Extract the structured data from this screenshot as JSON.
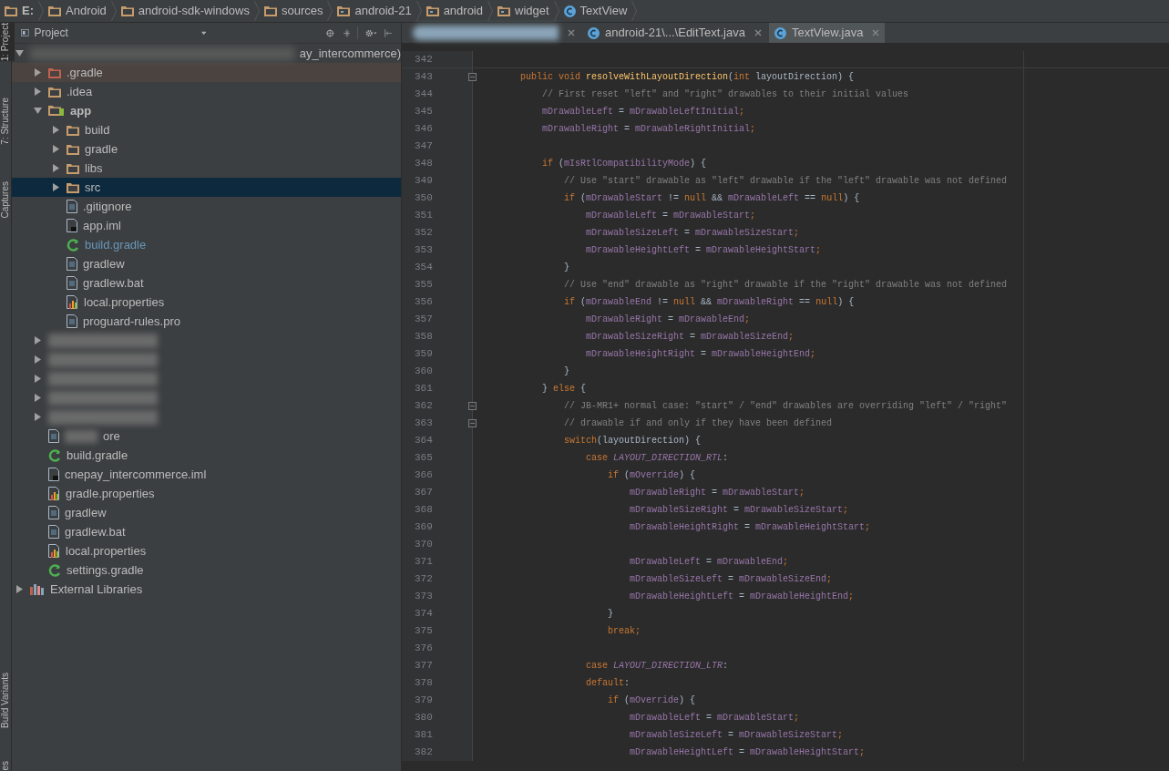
{
  "breadcrumbs": [
    {
      "label": "E:",
      "kind": "drive"
    },
    {
      "label": "Android",
      "kind": "folder"
    },
    {
      "label": "android-sdk-windows",
      "kind": "folder"
    },
    {
      "label": "sources",
      "kind": "folder"
    },
    {
      "label": "android-21",
      "kind": "package"
    },
    {
      "label": "android",
      "kind": "package"
    },
    {
      "label": "widget",
      "kind": "package"
    },
    {
      "label": "TextView",
      "kind": "class"
    }
  ],
  "tool_strip": {
    "top": [
      {
        "label": "1: Project",
        "selected": true
      },
      {
        "label": "7: Structure",
        "selected": false
      },
      {
        "label": "Captures",
        "selected": false
      }
    ],
    "bottom": [
      {
        "label": "Build Variants",
        "selected": false
      },
      {
        "label": "es",
        "selected": false
      }
    ]
  },
  "project_panel": {
    "title": "Project",
    "tree": [
      {
        "label": "ay_intercommerce)",
        "kind": "module",
        "redacted": true,
        "expanded": true,
        "selected": false,
        "children": [
          {
            "label": ".gradle",
            "kind": "folder-excluded",
            "expanded": false,
            "selected": false
          },
          {
            "label": ".idea",
            "kind": "folder",
            "expanded": false,
            "selected": false
          },
          {
            "label": "app",
            "kind": "module",
            "expanded": true,
            "selected": false,
            "children": [
              {
                "label": "build",
                "kind": "folder",
                "expanded": false,
                "selected": false
              },
              {
                "label": "gradle",
                "kind": "folder",
                "expanded": false,
                "selected": false
              },
              {
                "label": "libs",
                "kind": "folder",
                "expanded": false,
                "selected": false
              },
              {
                "label": "src",
                "kind": "folder",
                "expanded": false,
                "selected": true
              },
              {
                "label": ".gitignore",
                "kind": "file-text",
                "selected": false
              },
              {
                "label": "app.iml",
                "kind": "file-iml",
                "selected": false
              },
              {
                "label": "build.gradle",
                "kind": "gradle",
                "modified": true,
                "selected": false
              },
              {
                "label": "gradlew",
                "kind": "file-text",
                "selected": false
              },
              {
                "label": "gradlew.bat",
                "kind": "file-text",
                "selected": false
              },
              {
                "label": "local.properties",
                "kind": "properties",
                "selected": false
              },
              {
                "label": "proguard-rules.pro",
                "kind": "file-text",
                "selected": false
              }
            ]
          },
          {
            "kind": "redacted",
            "expanded": false,
            "selected": false
          },
          {
            "kind": "redacted",
            "expanded": false,
            "selected": false
          },
          {
            "kind": "redacted",
            "expanded": false,
            "selected": false
          },
          {
            "kind": "redacted",
            "expanded": false,
            "selected": false
          },
          {
            "kind": "redacted",
            "expanded": false,
            "selected": false
          },
          {
            "label": "ore",
            "kind": "file-text",
            "redacted": true,
            "selected": false
          },
          {
            "label": "build.gradle",
            "kind": "gradle",
            "selected": false
          },
          {
            "label": "cnepay_intercommerce.iml",
            "kind": "file-iml",
            "selected": false
          },
          {
            "label": "gradle.properties",
            "kind": "properties",
            "selected": false
          },
          {
            "label": "gradlew",
            "kind": "file-text",
            "selected": false
          },
          {
            "label": "gradlew.bat",
            "kind": "file-text",
            "selected": false
          },
          {
            "label": "local.properties",
            "kind": "properties",
            "selected": false
          },
          {
            "label": "settings.gradle",
            "kind": "gradle",
            "selected": false
          }
        ]
      },
      {
        "label": "External Libraries",
        "kind": "libraries",
        "expanded": false,
        "selected": false
      }
    ]
  },
  "tabs": [
    {
      "kind": "redacted",
      "selected": false
    },
    {
      "label": "android-21\\...\\EditText.java",
      "kind": "class",
      "selected": false
    },
    {
      "label": "TextView.java",
      "kind": "class",
      "selected": true
    }
  ],
  "code": [
    {
      "n": "342"
    },
    {
      "n": "343",
      "fold": true,
      "tokens": [
        {
          "kind": "keyword",
          "text": "    public void "
        },
        {
          "kind": "method",
          "text": "resolveWithLayoutDirection"
        },
        {
          "kind": "plain",
          "text": "("
        },
        {
          "kind": "keyword",
          "text": "int "
        },
        {
          "kind": "plain",
          "text": "layoutDirection) {"
        }
      ]
    },
    {
      "n": "344",
      "tokens": [
        {
          "kind": "comment",
          "text": "        // First reset \"left\" and \"right\" drawables to their initial values"
        }
      ]
    },
    {
      "n": "345",
      "tokens": [
        {
          "kind": "field",
          "text": "        mDrawableLeft"
        },
        {
          "kind": "plain",
          "text": " = "
        },
        {
          "kind": "field",
          "text": "mDrawableLeftInitial"
        },
        {
          "kind": "keyword",
          "text": ";"
        }
      ]
    },
    {
      "n": "346",
      "tokens": [
        {
          "kind": "field",
          "text": "        mDrawableRight"
        },
        {
          "kind": "plain",
          "text": " = "
        },
        {
          "kind": "field",
          "text": "mDrawableRightInitial"
        },
        {
          "kind": "keyword",
          "text": ";"
        }
      ]
    },
    {
      "n": "347"
    },
    {
      "n": "348",
      "tokens": [
        {
          "kind": "keyword",
          "text": "        if "
        },
        {
          "kind": "plain",
          "text": "("
        },
        {
          "kind": "field",
          "text": "mIsRtlCompatibilityMode"
        },
        {
          "kind": "plain",
          "text": ") {"
        }
      ]
    },
    {
      "n": "349",
      "tokens": [
        {
          "kind": "comment",
          "text": "            // Use \"start\" drawable as \"left\" drawable if the \"left\" drawable was not defined"
        }
      ]
    },
    {
      "n": "350",
      "tokens": [
        {
          "kind": "keyword",
          "text": "            if "
        },
        {
          "kind": "plain",
          "text": "("
        },
        {
          "kind": "field",
          "text": "mDrawableStart"
        },
        {
          "kind": "plain",
          "text": " != "
        },
        {
          "kind": "keyword",
          "text": "null"
        },
        {
          "kind": "plain",
          "text": " && "
        },
        {
          "kind": "field",
          "text": "mDrawableLeft"
        },
        {
          "kind": "plain",
          "text": " == "
        },
        {
          "kind": "keyword",
          "text": "null"
        },
        {
          "kind": "plain",
          "text": ") {"
        }
      ]
    },
    {
      "n": "351",
      "tokens": [
        {
          "kind": "field",
          "text": "                mDrawableLeft"
        },
        {
          "kind": "plain",
          "text": " = "
        },
        {
          "kind": "field",
          "text": "mDrawableStart"
        },
        {
          "kind": "keyword",
          "text": ";"
        }
      ]
    },
    {
      "n": "352",
      "tokens": [
        {
          "kind": "field",
          "text": "                mDrawableSizeLeft"
        },
        {
          "kind": "plain",
          "text": " = "
        },
        {
          "kind": "field",
          "text": "mDrawableSizeStart"
        },
        {
          "kind": "keyword",
          "text": ";"
        }
      ]
    },
    {
      "n": "353",
      "tokens": [
        {
          "kind": "field",
          "text": "                mDrawableHeightLeft"
        },
        {
          "kind": "plain",
          "text": " = "
        },
        {
          "kind": "field",
          "text": "mDrawableHeightStart"
        },
        {
          "kind": "keyword",
          "text": ";"
        }
      ]
    },
    {
      "n": "354",
      "tokens": [
        {
          "kind": "plain",
          "text": "            }"
        }
      ]
    },
    {
      "n": "355",
      "tokens": [
        {
          "kind": "comment",
          "text": "            // Use \"end\" drawable as \"right\" drawable if the \"right\" drawable was not defined"
        }
      ]
    },
    {
      "n": "356",
      "tokens": [
        {
          "kind": "keyword",
          "text": "            if "
        },
        {
          "kind": "plain",
          "text": "("
        },
        {
          "kind": "field",
          "text": "mDrawableEnd"
        },
        {
          "kind": "plain",
          "text": " != "
        },
        {
          "kind": "keyword",
          "text": "null"
        },
        {
          "kind": "plain",
          "text": " && "
        },
        {
          "kind": "field",
          "text": "mDrawableRight"
        },
        {
          "kind": "plain",
          "text": " == "
        },
        {
          "kind": "keyword",
          "text": "null"
        },
        {
          "kind": "plain",
          "text": ") {"
        }
      ]
    },
    {
      "n": "357",
      "tokens": [
        {
          "kind": "field",
          "text": "                mDrawableRight"
        },
        {
          "kind": "plain",
          "text": " = "
        },
        {
          "kind": "field",
          "text": "mDrawableEnd"
        },
        {
          "kind": "keyword",
          "text": ";"
        }
      ]
    },
    {
      "n": "358",
      "tokens": [
        {
          "kind": "field",
          "text": "                mDrawableSizeRight"
        },
        {
          "kind": "plain",
          "text": " = "
        },
        {
          "kind": "field",
          "text": "mDrawableSizeEnd"
        },
        {
          "kind": "keyword",
          "text": ";"
        }
      ]
    },
    {
      "n": "359",
      "tokens": [
        {
          "kind": "field",
          "text": "                mDrawableHeightRight"
        },
        {
          "kind": "plain",
          "text": " = "
        },
        {
          "kind": "field",
          "text": "mDrawableHeightEnd"
        },
        {
          "kind": "keyword",
          "text": ";"
        }
      ]
    },
    {
      "n": "360",
      "tokens": [
        {
          "kind": "plain",
          "text": "            }"
        }
      ]
    },
    {
      "n": "361",
      "tokens": [
        {
          "kind": "plain",
          "text": "        } "
        },
        {
          "kind": "keyword",
          "text": "else "
        },
        {
          "kind": "plain",
          "text": "{"
        }
      ]
    },
    {
      "n": "362",
      "fold": true,
      "tokens": [
        {
          "kind": "comment",
          "text": "            // JB-MR1+ normal case: \"start\" / \"end\" drawables are overriding \"left\" / \"right\""
        }
      ]
    },
    {
      "n": "363",
      "fold": true,
      "tokens": [
        {
          "kind": "comment",
          "text": "            // drawable if and only if they have been defined"
        }
      ]
    },
    {
      "n": "364",
      "tokens": [
        {
          "kind": "keyword",
          "text": "            switch"
        },
        {
          "kind": "plain",
          "text": "(layoutDirection) {"
        }
      ]
    },
    {
      "n": "365",
      "tokens": [
        {
          "kind": "keyword",
          "text": "                case "
        },
        {
          "kind": "constant",
          "text": "LAYOUT_DIRECTION_RTL"
        },
        {
          "kind": "plain",
          "text": ":"
        }
      ]
    },
    {
      "n": "366",
      "tokens": [
        {
          "kind": "keyword",
          "text": "                    if "
        },
        {
          "kind": "plain",
          "text": "("
        },
        {
          "kind": "field",
          "text": "mOverride"
        },
        {
          "kind": "plain",
          "text": ") {"
        }
      ]
    },
    {
      "n": "367",
      "tokens": [
        {
          "kind": "field",
          "text": "                        mDrawableRight"
        },
        {
          "kind": "plain",
          "text": " = "
        },
        {
          "kind": "field",
          "text": "mDrawableStart"
        },
        {
          "kind": "keyword",
          "text": ";"
        }
      ]
    },
    {
      "n": "368",
      "tokens": [
        {
          "kind": "field",
          "text": "                        mDrawableSizeRight"
        },
        {
          "kind": "plain",
          "text": " = "
        },
        {
          "kind": "field",
          "text": "mDrawableSizeStart"
        },
        {
          "kind": "keyword",
          "text": ";"
        }
      ]
    },
    {
      "n": "369",
      "tokens": [
        {
          "kind": "field",
          "text": "                        mDrawableHeightRight"
        },
        {
          "kind": "plain",
          "text": " = "
        },
        {
          "kind": "field",
          "text": "mDrawableHeightStart"
        },
        {
          "kind": "keyword",
          "text": ";"
        }
      ]
    },
    {
      "n": "370"
    },
    {
      "n": "371",
      "tokens": [
        {
          "kind": "field",
          "text": "                        mDrawableLeft"
        },
        {
          "kind": "plain",
          "text": " = "
        },
        {
          "kind": "field",
          "text": "mDrawableEnd"
        },
        {
          "kind": "keyword",
          "text": ";"
        }
      ]
    },
    {
      "n": "372",
      "tokens": [
        {
          "kind": "field",
          "text": "                        mDrawableSizeLeft"
        },
        {
          "kind": "plain",
          "text": " = "
        },
        {
          "kind": "field",
          "text": "mDrawableSizeEnd"
        },
        {
          "kind": "keyword",
          "text": ";"
        }
      ]
    },
    {
      "n": "373",
      "tokens": [
        {
          "kind": "field",
          "text": "                        mDrawableHeightLeft"
        },
        {
          "kind": "plain",
          "text": " = "
        },
        {
          "kind": "field",
          "text": "mDrawableHeightEnd"
        },
        {
          "kind": "keyword",
          "text": ";"
        }
      ]
    },
    {
      "n": "374",
      "tokens": [
        {
          "kind": "plain",
          "text": "                    }"
        }
      ]
    },
    {
      "n": "375",
      "tokens": [
        {
          "kind": "keyword",
          "text": "                    break;"
        }
      ]
    },
    {
      "n": "376"
    },
    {
      "n": "377",
      "tokens": [
        {
          "kind": "keyword",
          "text": "                case "
        },
        {
          "kind": "constant",
          "text": "LAYOUT_DIRECTION_LTR"
        },
        {
          "kind": "plain",
          "text": ":"
        }
      ]
    },
    {
      "n": "378",
      "tokens": [
        {
          "kind": "keyword",
          "text": "                default"
        },
        {
          "kind": "plain",
          "text": ":"
        }
      ]
    },
    {
      "n": "379",
      "tokens": [
        {
          "kind": "keyword",
          "text": "                    if "
        },
        {
          "kind": "plain",
          "text": "("
        },
        {
          "kind": "field",
          "text": "mOverride"
        },
        {
          "kind": "plain",
          "text": ") {"
        }
      ]
    },
    {
      "n": "380",
      "tokens": [
        {
          "kind": "field",
          "text": "                        mDrawableLeft"
        },
        {
          "kind": "plain",
          "text": " = "
        },
        {
          "kind": "field",
          "text": "mDrawableStart"
        },
        {
          "kind": "keyword",
          "text": ";"
        }
      ]
    },
    {
      "n": "381",
      "tokens": [
        {
          "kind": "field",
          "text": "                        mDrawableSizeLeft"
        },
        {
          "kind": "plain",
          "text": " = "
        },
        {
          "kind": "field",
          "text": "mDrawableSizeStart"
        },
        {
          "kind": "keyword",
          "text": ";"
        }
      ]
    },
    {
      "n": "382",
      "tokens": [
        {
          "kind": "field",
          "text": "                        mDrawableHeightLeft"
        },
        {
          "kind": "plain",
          "text": " = "
        },
        {
          "kind": "field",
          "text": "mDrawableHeightStart"
        },
        {
          "kind": "keyword",
          "text": ";"
        }
      ]
    }
  ]
}
